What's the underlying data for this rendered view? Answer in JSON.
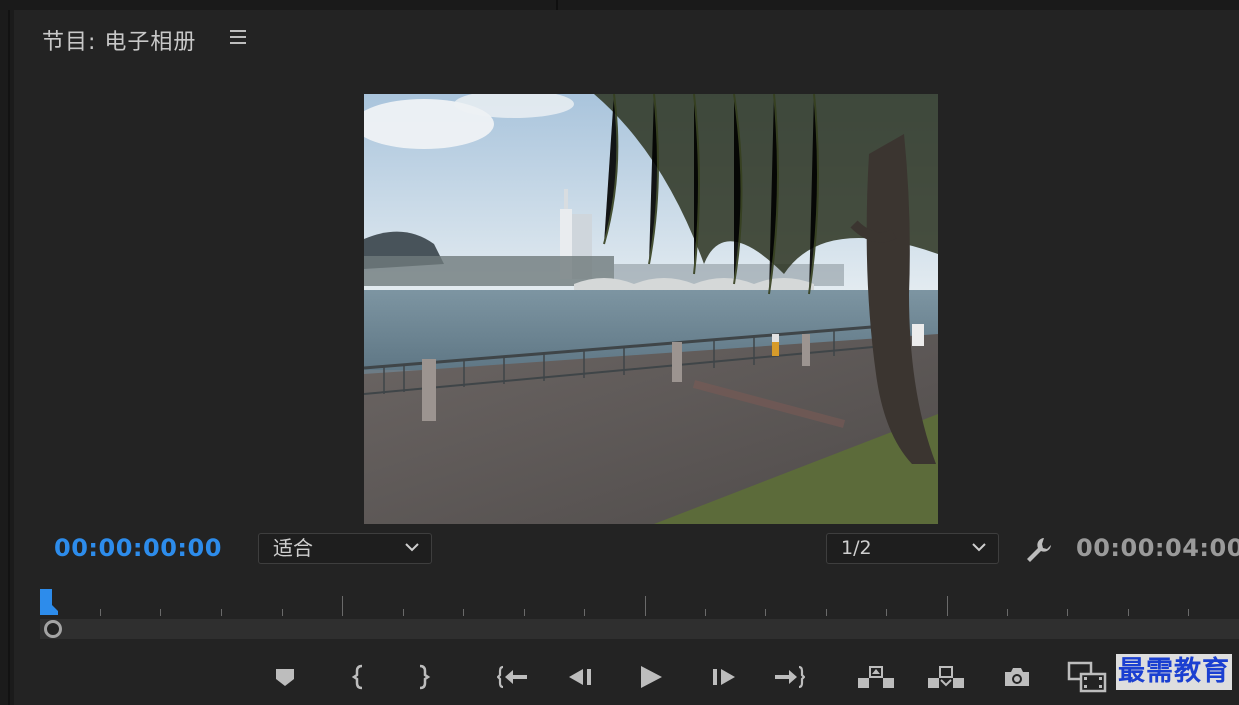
{
  "panel": {
    "title": "节目: 电子相册"
  },
  "viewer": {
    "current_timecode": "00:00:00:00",
    "duration_timecode": "00:00:04:00",
    "fit_dropdown": {
      "selected": "适合"
    },
    "resolution_dropdown": {
      "selected": "1/2"
    }
  },
  "transport": {
    "buttons": [
      {
        "id": "add-marker",
        "icon": "marker-icon"
      },
      {
        "id": "mark-in",
        "icon": "mark-in-icon"
      },
      {
        "id": "mark-out",
        "icon": "mark-out-icon"
      },
      {
        "id": "go-to-in",
        "icon": "go-to-in-icon"
      },
      {
        "id": "step-back",
        "icon": "step-back-icon"
      },
      {
        "id": "play",
        "icon": "play-icon"
      },
      {
        "id": "step-forward",
        "icon": "step-forward-icon"
      },
      {
        "id": "go-to-out",
        "icon": "go-to-out-icon"
      },
      {
        "id": "lift",
        "icon": "lift-icon"
      },
      {
        "id": "extract",
        "icon": "extract-icon"
      },
      {
        "id": "export-frame",
        "icon": "camera-icon"
      },
      {
        "id": "comparison-view",
        "icon": "comparison-icon"
      }
    ]
  },
  "watermark": {
    "text": "最需教育"
  },
  "colors": {
    "accent": "#2d8ceb",
    "background": "#232323",
    "icon": "#bdbdbd"
  }
}
